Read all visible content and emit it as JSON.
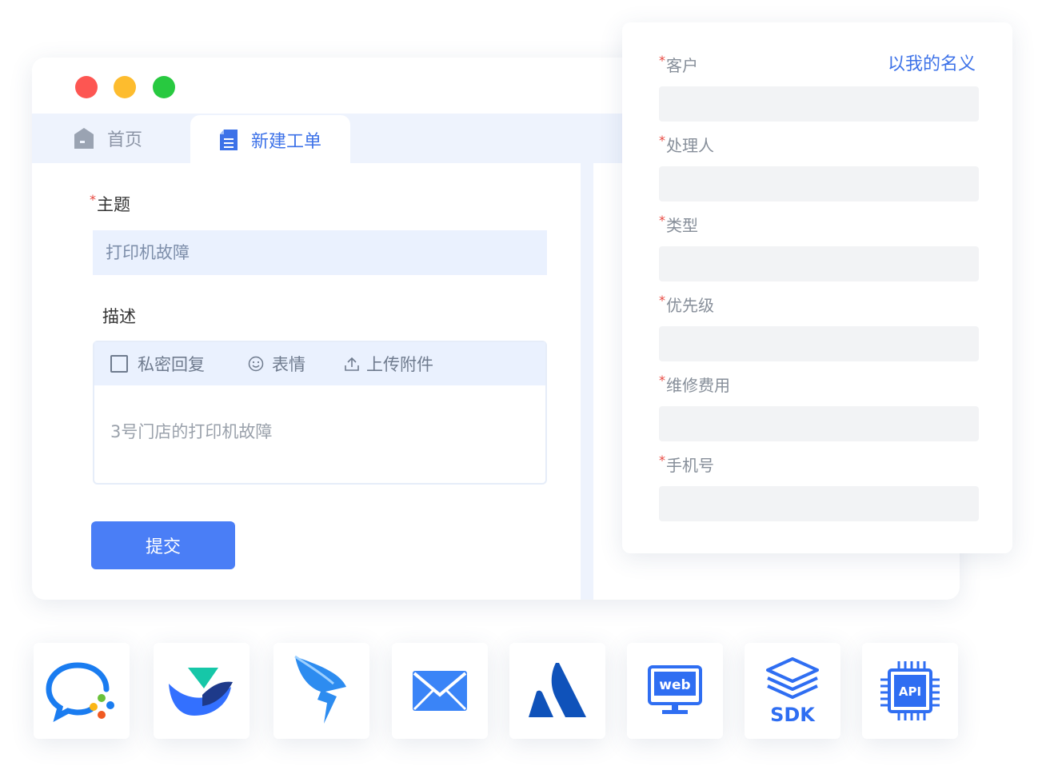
{
  "tabs": {
    "home": "首页",
    "new_ticket": "新建工单"
  },
  "form": {
    "required_mark": "*",
    "subject_label": "主题",
    "subject_value": "打印机故障",
    "desc_label": "描述",
    "toolbar": {
      "private_reply": "私密回复",
      "emoji": "表情",
      "upload": "上传附件"
    },
    "desc_value": "3号门店的打印机故障",
    "submit": "提交"
  },
  "panel": {
    "link": "以我的名义",
    "fields": [
      "客户",
      "处理人",
      "类型",
      "优先级",
      "维修费用",
      "手机号"
    ]
  },
  "integrations": [
    {
      "name": "wecom-icon"
    },
    {
      "name": "feishu-icon"
    },
    {
      "name": "dingtalk-icon"
    },
    {
      "name": "email-icon"
    },
    {
      "name": "atlassian-icon"
    },
    {
      "name": "web-icon",
      "label": "web"
    },
    {
      "name": "sdk-icon",
      "label": "SDK"
    },
    {
      "name": "api-icon",
      "label": "API"
    }
  ],
  "colors": {
    "primary": "#4a7ef6",
    "required": "#e8473f",
    "tab_bg": "#eef3fd"
  }
}
